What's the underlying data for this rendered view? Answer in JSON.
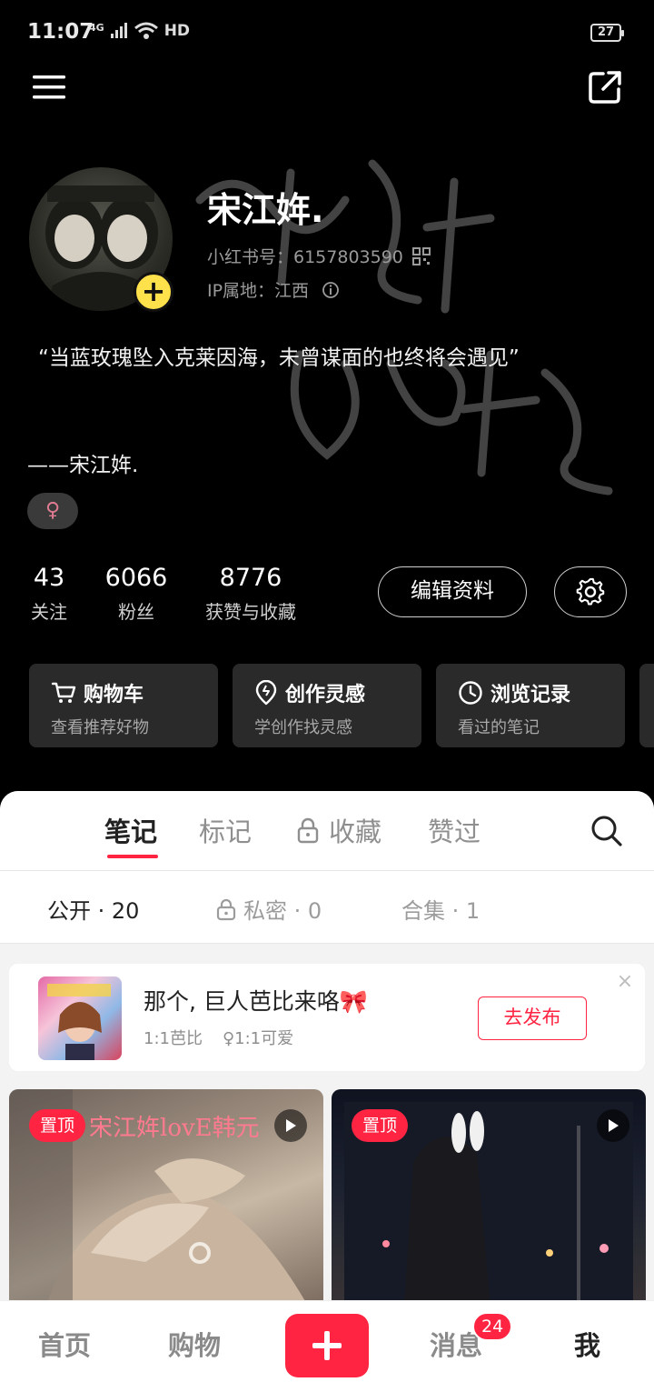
{
  "status_bar": {
    "time": "11:07",
    "network": "4G",
    "hd": "HD",
    "battery": "27"
  },
  "icons": {
    "menu": "hamburger-menu-icon",
    "share": "share-external-icon",
    "qr": "qr-code-icon",
    "info": "info-icon",
    "gear": "gear-icon",
    "search": "search-icon",
    "lock": "lock-icon",
    "play": "play-icon",
    "close": "close-icon"
  },
  "profile": {
    "nickname": "宋江姩.",
    "red_id_label": "小红书号：6157803590",
    "ip_label": "IP属地：江西",
    "bio": "“当蓝玫瑰坠入克莱因海，未曾谋面的也终将会遇见”",
    "signature": "——宋江姩.",
    "gender": "♀",
    "avatar_add": "+"
  },
  "stats": [
    {
      "value": "43",
      "label": "关注"
    },
    {
      "value": "6066",
      "label": "粉丝"
    },
    {
      "value": "8776",
      "label": "获赞与收藏"
    }
  ],
  "actions": {
    "edit_profile": "编辑资料"
  },
  "quick_cards": [
    {
      "title": "购物车",
      "subtitle": "查看推荐好物",
      "icon": "cart-icon"
    },
    {
      "title": "创作灵感",
      "subtitle": "学创作找灵感",
      "icon": "bulb-icon"
    },
    {
      "title": "浏览记录",
      "subtitle": "看过的笔记",
      "icon": "clock-icon"
    }
  ],
  "tabs": [
    {
      "label": "笔记",
      "active": true
    },
    {
      "label": "标记",
      "active": false
    },
    {
      "label": "收藏",
      "active": false,
      "locked": true
    },
    {
      "label": "赞过",
      "active": false
    }
  ],
  "subtabs": [
    {
      "label": "公开 · 20",
      "active": true
    },
    {
      "label": "私密 · 0",
      "active": false,
      "locked": true
    },
    {
      "label": "合集 · 1",
      "active": false
    }
  ],
  "draft_card": {
    "title": "那个, 巨人芭比来咯🎀",
    "tag1": "1:1芭比",
    "tag2": "♀1:1可爱",
    "publish": "去发布",
    "close": "×"
  },
  "notes": [
    {
      "badge": "置顶",
      "caption": "宋江姩lovE韩元",
      "type": "video"
    },
    {
      "badge": "置顶",
      "type": "video"
    }
  ],
  "bottom_nav": {
    "home": "首页",
    "shop": "购物",
    "plus": "+",
    "messages": "消息",
    "messages_badge": "24",
    "me": "我"
  },
  "colors": {
    "accent": "#ff2442",
    "badge_yellow": "#ffe14b",
    "dark_bg": "#000000",
    "card_dark": "#2a2a2a"
  }
}
